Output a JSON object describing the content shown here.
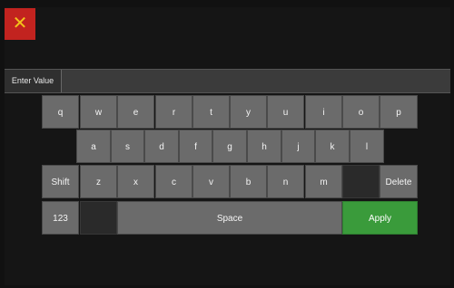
{
  "close": {
    "symbol": "✕"
  },
  "input": {
    "label": "Enter Value",
    "value": ""
  },
  "keyboard": {
    "row1": [
      "q",
      "w",
      "e",
      "r",
      "t",
      "y",
      "u",
      "i",
      "o",
      "p"
    ],
    "row2": [
      "a",
      "s",
      "d",
      "f",
      "g",
      "h",
      "j",
      "k",
      "l"
    ],
    "row3": [
      "z",
      "x",
      "c",
      "v",
      "b",
      "n",
      "m"
    ],
    "shift": "Shift",
    "delete": "Delete",
    "numbers": "123",
    "space": "Space",
    "apply": "Apply"
  },
  "colors": {
    "apply": "#3a9b3b",
    "close": "#c2231f",
    "close_icon": "#f3c21b"
  }
}
